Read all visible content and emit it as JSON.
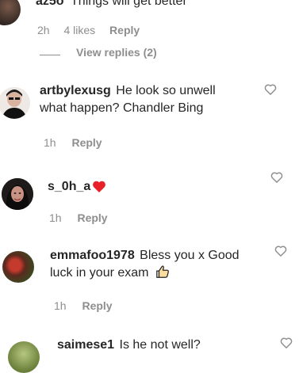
{
  "comments": [
    {
      "username": "az5o",
      "text": "Things will get better",
      "time": "2h",
      "likes": "4 likes",
      "reply": "Reply",
      "view_replies": "View replies (2)"
    },
    {
      "username": "artbylexusg",
      "text": "He look so unwell",
      "text_line2": "what happen? Chandler Bing",
      "time": "1h",
      "reply": "Reply"
    },
    {
      "username": "s_0h_a",
      "text": "",
      "emoji": "❤",
      "time": "1h",
      "reply": "Reply"
    },
    {
      "username": "emmafoo1978",
      "text": "Bless you x Good",
      "text_line2": "luck in your exam",
      "emoji": "👍",
      "time": "1h",
      "reply": "Reply"
    },
    {
      "username": "saimese1",
      "text": "Is he not well?"
    }
  ],
  "colors": {
    "text": "#262626",
    "muted": "#8e8e8e",
    "heart_red": "#ed4956",
    "divider": "#dbdbdb"
  },
  "icons": [
    "heart-outline-icon",
    "red-heart-emoji",
    "thumbs-up-emoji"
  ]
}
